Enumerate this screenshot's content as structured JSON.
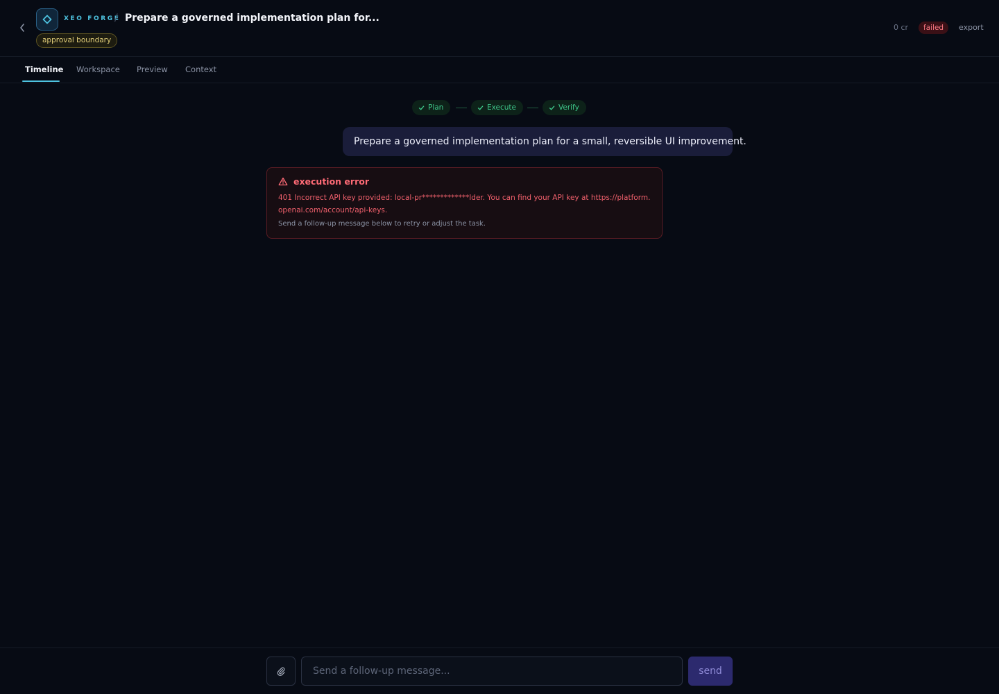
{
  "header": {
    "brand": "XEO FORGE",
    "separator": "/",
    "title": "Prepare a governed implementation plan for...",
    "approval_badge": "approval boundary",
    "credits": "0 cr",
    "status": "failed",
    "export_label": "export"
  },
  "tabs": [
    {
      "label": "Timeline",
      "active": true
    },
    {
      "label": "Workspace",
      "active": false
    },
    {
      "label": "Preview",
      "active": false
    },
    {
      "label": "Context",
      "active": false
    }
  ],
  "steps": [
    {
      "label": "Plan",
      "status": "done"
    },
    {
      "label": "Execute",
      "status": "done"
    },
    {
      "label": "Verify",
      "status": "done"
    }
  ],
  "user_message": "Prepare a governed implementation plan for a small, reversible UI improvement.",
  "error": {
    "title": "execution error",
    "message": "401 Incorrect API key provided: local-pr*************lder. You can find your API key at https://platform.openai.com/account/api-keys.",
    "hint": "Send a follow-up message below to retry or adjust the task."
  },
  "composer": {
    "placeholder": "Send a follow-up message...",
    "send_label": "send"
  },
  "colors": {
    "background": "#070b14",
    "accent": "#4ec3e0",
    "success": "#3ec78a",
    "error": "#ff6b76",
    "user_bubble": "#1a1d3a"
  }
}
